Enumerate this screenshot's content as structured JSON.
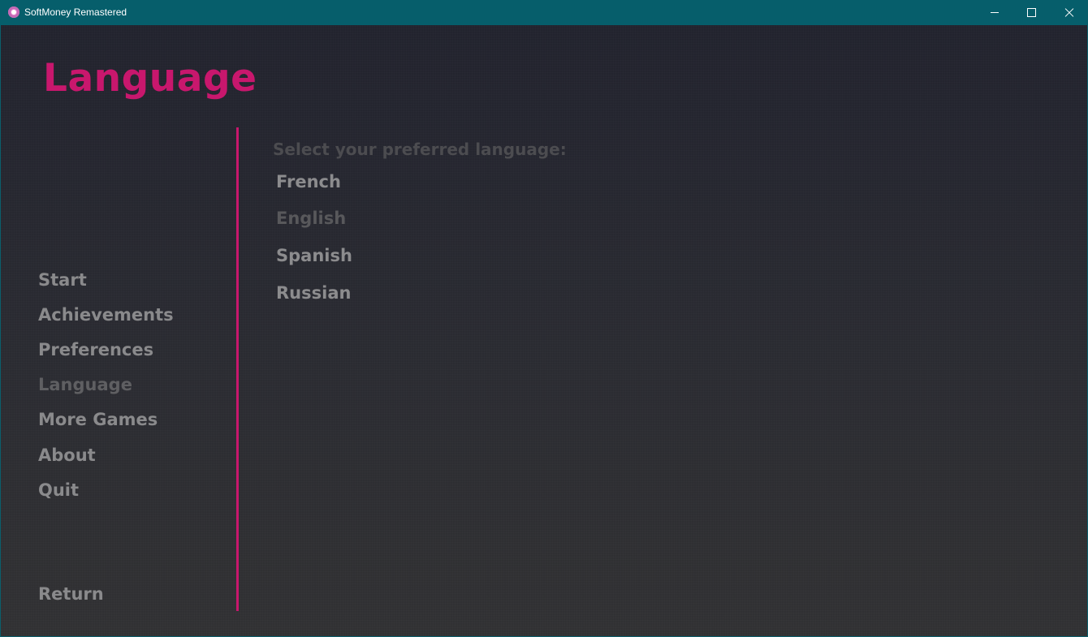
{
  "window": {
    "title": "SoftMoney Remastered",
    "icon": "app-icon"
  },
  "screen": {
    "title": "Language",
    "accent_color": "#c8176d"
  },
  "menu": {
    "items": [
      {
        "label": "Start",
        "selected": false
      },
      {
        "label": "Achievements",
        "selected": false
      },
      {
        "label": "Preferences",
        "selected": false
      },
      {
        "label": "Language",
        "selected": true
      },
      {
        "label": "More Games",
        "selected": false
      },
      {
        "label": "About",
        "selected": false
      },
      {
        "label": "Quit",
        "selected": false
      }
    ],
    "return_label": "Return"
  },
  "language_panel": {
    "prompt": "Select your preferred language:",
    "options": [
      {
        "label": "French",
        "active": false
      },
      {
        "label": "English",
        "active": true
      },
      {
        "label": "Spanish",
        "active": false
      },
      {
        "label": "Russian",
        "active": false
      }
    ]
  }
}
